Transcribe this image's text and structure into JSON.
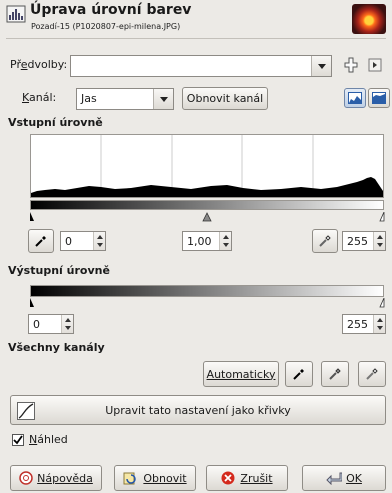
{
  "header": {
    "title": "Úprava úrovní barev",
    "subtitle": "Pozadí-15 (P1020807-epi-milena.JPG)"
  },
  "presets": {
    "label": "Předvolby:",
    "value": ""
  },
  "channel": {
    "label": "Kanál:",
    "value": "Jas",
    "reset_label": "Obnovit kanál"
  },
  "input_levels": {
    "heading": "Vstupní úrovně",
    "black": "0",
    "gamma": "1,00",
    "white": "255"
  },
  "output_levels": {
    "heading": "Výstupní úrovně",
    "low": "0",
    "high": "255"
  },
  "all_channels": {
    "heading": "Všechny kanály",
    "auto_label": "Automaticky"
  },
  "curves_button": "Upravit tato nastavení jako křivky",
  "preview": {
    "label": "Náhled",
    "checked": true
  },
  "footer": {
    "help": "Nápověda",
    "reset": "Obnovit",
    "cancel": "Zrušit",
    "ok": "OK"
  },
  "colors": {
    "accent_cancel": "#d42a1d",
    "histogram": "#000000"
  }
}
